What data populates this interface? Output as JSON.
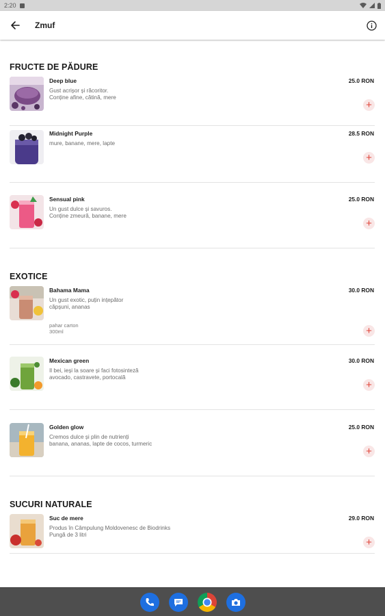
{
  "status_bar": {
    "time": "2:20"
  },
  "app_bar": {
    "title": "Zmuf"
  },
  "colors": {
    "accent": "#e0453a",
    "nav_bar": "#4e4e4e",
    "dock_blue": "#1e6fe0"
  },
  "sections": [
    {
      "title": "FRUCTE DE PĂDURE",
      "items": [
        {
          "name": "Deep blue",
          "description": "Gust acrișor și răcoritor.\nConține afine, cătină, mere",
          "extra": "",
          "price": "25.0 RON",
          "image": "purple-smoothie-bowl"
        },
        {
          "name": "Midnight Purple",
          "description": "mure, banane, mere, lapte",
          "extra": "",
          "price": "28.5 RON",
          "image": "blackberry-smoothie-jar"
        },
        {
          "name": "Sensual pink",
          "description": "Un gust dulce și savuros.\nConține zmeură, banane, mere",
          "extra": "",
          "price": "25.0 RON",
          "image": "pink-raspberry-smoothie"
        }
      ]
    },
    {
      "title": "EXOTICE",
      "items": [
        {
          "name": "Bahama Mama",
          "description": "Un gust exotic, puțin ințepător\ncăpșuni, ananas",
          "extra": "pahar carton\n300ml",
          "price": "30.0 RON",
          "image": "strawberry-pineapple-smoothie"
        },
        {
          "name": "Mexican green",
          "description": "Il bei, ieși la soare și faci fotosinteză\navocado, castravete, portocală",
          "extra": "",
          "price": "30.0 RON",
          "image": "green-smoothie"
        },
        {
          "name": "Golden glow",
          "description": "Cremos dulce și plin de nutrienți\nbanana, ananas, lapte de cocos, turmeric",
          "extra": "",
          "price": "25.0 RON",
          "image": "golden-smoothie"
        }
      ]
    },
    {
      "title": "SUCURI NATURALE",
      "items": [
        {
          "name": "Suc de mere",
          "description": "Produs în Câmpulung Moldovenesc de Biodrinks\nPungă de 3 litri",
          "extra": "",
          "price": "29.0 RON",
          "image": "apple-juice"
        }
      ]
    }
  ],
  "add_label": "+",
  "dock": [
    {
      "icon": "phone-icon"
    },
    {
      "icon": "messages-icon"
    },
    {
      "icon": "chrome-icon"
    },
    {
      "icon": "camera-icon"
    }
  ]
}
